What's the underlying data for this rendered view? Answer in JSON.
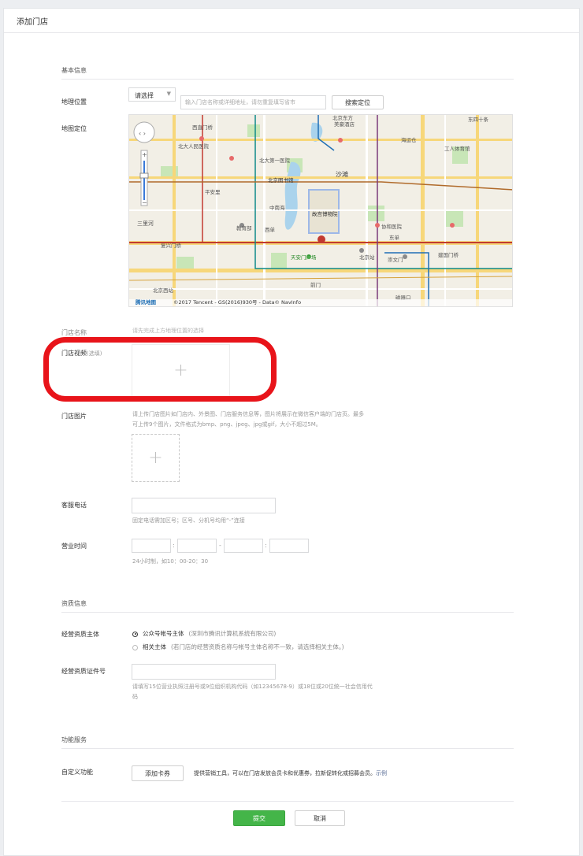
{
  "page": {
    "title": "添加门店"
  },
  "sections": {
    "basic": "基本信息",
    "qualification": "资质信息",
    "features": "功能服务"
  },
  "location": {
    "label": "地理位置",
    "select_value": "请选择",
    "input_placeholder": "输入门店名称或详细地址，请勿重复填写省市",
    "search_button": "搜索定位"
  },
  "map": {
    "label": "地图定位",
    "copyright": "©2017 Tencent - GS(2016)930号 - Data© NavInfo",
    "brand": "腾讯地图",
    "places": [
      "北京东方美豪酒店",
      "海运仓",
      "北大人民医院",
      "西直门桥",
      "北大第一医院",
      "沙滩",
      "北京图书馆",
      "故宫博物院",
      "协和医院",
      "三里河",
      "天安门广场",
      "北京站",
      "西单",
      "前门",
      "崇文门",
      "东单",
      "北京西站",
      "复兴门桥",
      "建国门桥",
      "东四十条",
      "工人体育馆",
      "平安里",
      "教育部",
      "中南海",
      "磁器口"
    ]
  },
  "store_name": {
    "label": "门店名称",
    "hint": "请先完成上方地理位置的选择"
  },
  "store_video": {
    "label": "门店视频",
    "optional": "(选填)"
  },
  "store_images": {
    "label": "门店图片",
    "hint_line1": "请上传门店图片如门店内、外景图、门店服务信息等，图片将展示在微信客户端的门店页。最多",
    "hint_line2": "可上传9个图片，文件格式为bmp、png、jpeg、jpg或gif，大小不超过5M。"
  },
  "phone": {
    "label": "客服电话",
    "hint": "固定电话需加区号；区号、分机号均用“-”连接"
  },
  "hours": {
    "label": "营业时间",
    "separator": ":",
    "dash": "-",
    "hint": "24小时制，如10：00-20：30"
  },
  "entity": {
    "label": "经营资质主体",
    "option1": "公众号帐号主体",
    "option1_note": "(深圳市腾讯计算机系统有限公司)",
    "option2": "相关主体",
    "option2_note": "(若门店的经营资质名称与帐号主体名称不一致，请选择相关主体。)"
  },
  "license": {
    "label": "经营资质证件号",
    "hint_line1": "请填写15位营业执照注册号或9位组织机构代码（如12345678-9）或18位或20位统一社会信用代",
    "hint_line2": "码"
  },
  "custom": {
    "label": "自定义功能",
    "button": "添加卡券",
    "desc": "提供营销工具，可以在门店发放会员卡和优惠券，拉新促转化或招募会员。",
    "link": "示例"
  },
  "actions": {
    "submit": "提交",
    "cancel": "取消"
  },
  "colors": {
    "accent": "#44b549",
    "highlight": "#e8141a",
    "link": "#576b95"
  }
}
